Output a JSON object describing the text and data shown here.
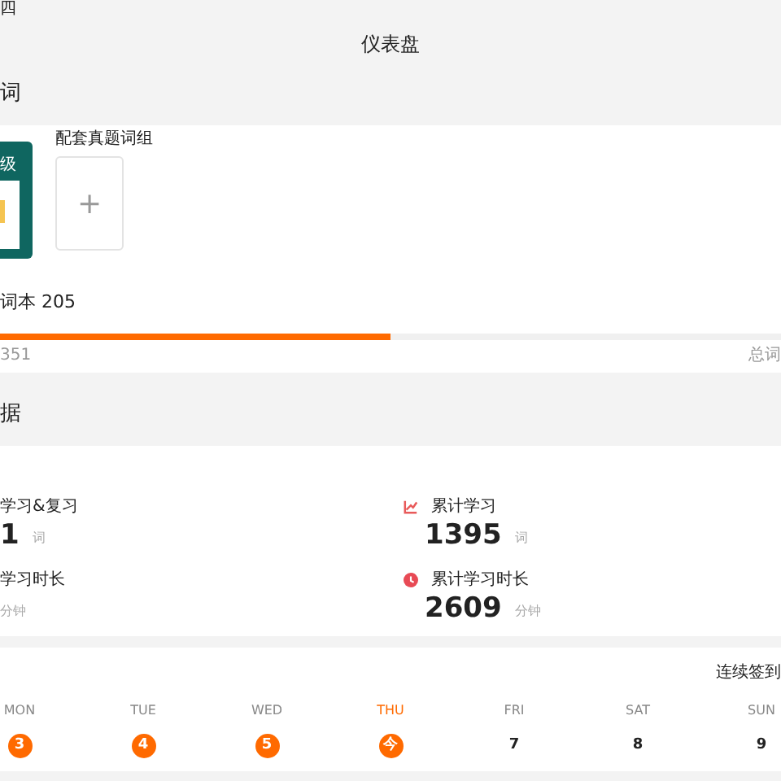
{
  "status_bar": {
    "weekday": "四"
  },
  "header": {
    "title": "仪表盘"
  },
  "wordbook": {
    "heading": "词",
    "books": [
      {
        "kind": "cover",
        "title": "级"
      },
      {
        "kind": "add",
        "label": "配套真题词组",
        "icon": "+"
      }
    ],
    "count_label": "词本 205",
    "progress": {
      "level": 0.5,
      "learned": "351",
      "total": "总词"
    }
  },
  "stats": {
    "heading": "据",
    "items": [
      {
        "label": "学习&复习",
        "value": "1",
        "unit": "词"
      },
      {
        "label": "累计学习",
        "value": "1395",
        "unit": "词",
        "kind": "chart"
      },
      {
        "label": "学习时长",
        "unit": "分钟"
      },
      {
        "label": "累计学习时长",
        "value": "2609",
        "unit": "分钟",
        "kind": "clock"
      }
    ]
  },
  "calendar": {
    "streak_label": "连续签到",
    "days": [
      {
        "weekday": "MON",
        "date": "3",
        "checked": true,
        "selected": false
      },
      {
        "weekday": "TUE",
        "date": "4",
        "checked": true,
        "selected": false
      },
      {
        "weekday": "WED",
        "date": "5",
        "checked": true,
        "selected": false
      },
      {
        "weekday": "THU",
        "date": "今",
        "checked": true,
        "selected": true
      },
      {
        "weekday": "FRI",
        "date": "7",
        "checked": false,
        "selected": false
      },
      {
        "weekday": "SAT",
        "date": "8",
        "checked": false,
        "selected": false
      },
      {
        "weekday": "SUN",
        "date": "9",
        "checked": false,
        "selected": false
      }
    ]
  }
}
